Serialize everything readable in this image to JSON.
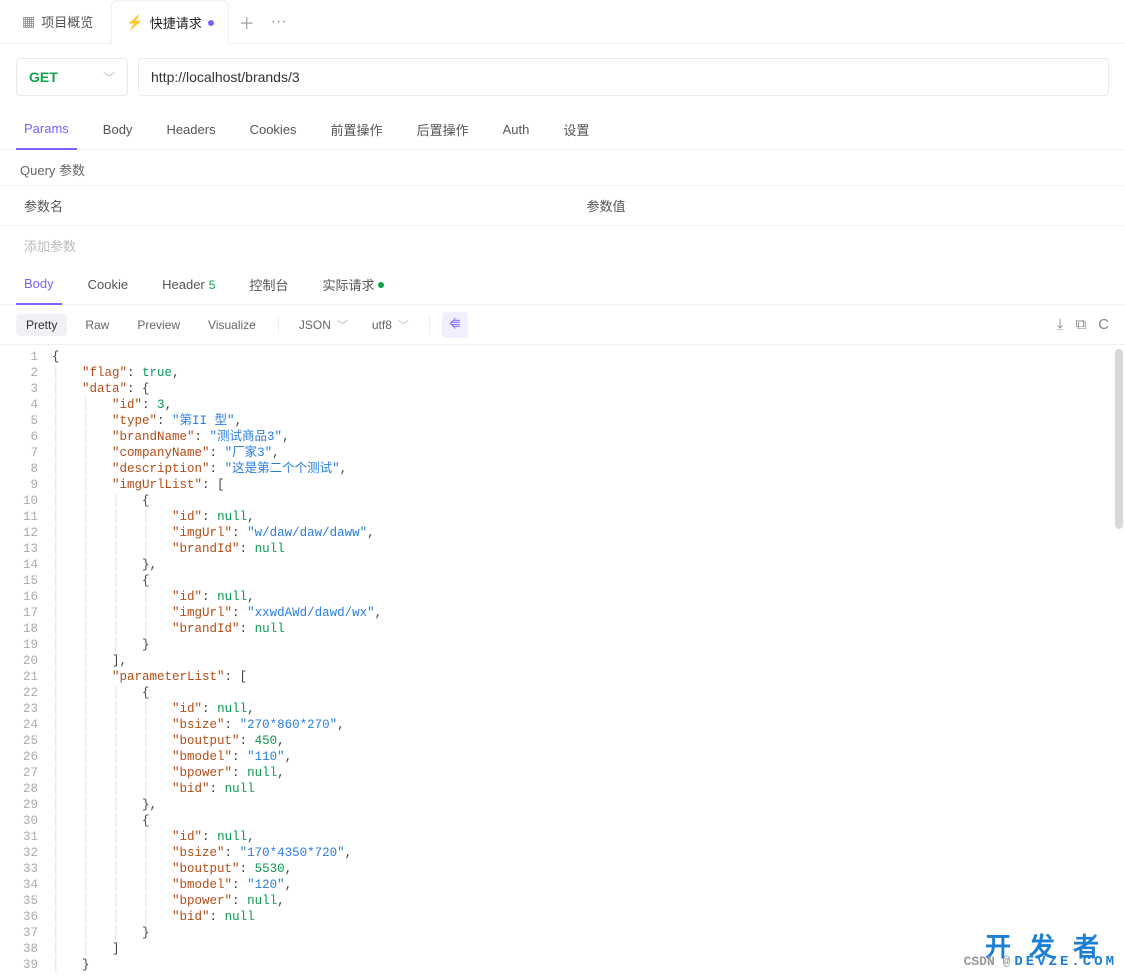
{
  "topTabs": {
    "overview": "项目概览",
    "quick": "快捷请求"
  },
  "request": {
    "method": "GET",
    "url": "http://localhost/brands/3"
  },
  "reqTabs": {
    "params": "Params",
    "body": "Body",
    "headers": "Headers",
    "cookies": "Cookies",
    "pre": "前置操作",
    "post": "后置操作",
    "auth": "Auth",
    "settings": "设置"
  },
  "querySection": {
    "title": "Query 参数",
    "colName": "参数名",
    "colValue": "参数值",
    "addPlaceholder": "添加参数"
  },
  "respTabs": {
    "body": "Body",
    "cookie": "Cookie",
    "header": "Header",
    "headerCount": "5",
    "console": "控制台",
    "actual": "实际请求"
  },
  "respToolbar": {
    "pretty": "Pretty",
    "raw": "Raw",
    "preview": "Preview",
    "visualize": "Visualize",
    "format": "JSON",
    "encoding": "utf8"
  },
  "responseBody": {
    "flag": true,
    "data": {
      "id": 3,
      "type": "第II 型",
      "brandName": "测试商品3",
      "companyName": "厂家3",
      "description": "这是第二个个测试",
      "imgUrlList": [
        {
          "id": null,
          "imgUrl": "w/daw/daw/daww",
          "brandId": null
        },
        {
          "id": null,
          "imgUrl": "xxwdAWd/dawd/wx",
          "brandId": null
        }
      ],
      "parameterList": [
        {
          "id": null,
          "bsize": "270*860*270",
          "boutput": 450,
          "bmodel": "110",
          "bpower": null,
          "bid": null
        },
        {
          "id": null,
          "bsize": "170*4350*720",
          "boutput": 5530,
          "bmodel": "120",
          "bpower": null,
          "bid": null
        }
      ]
    }
  },
  "watermark": {
    "line1": "开发者",
    "line2": "CSDN @",
    "line3": "DEVZE.COM"
  }
}
